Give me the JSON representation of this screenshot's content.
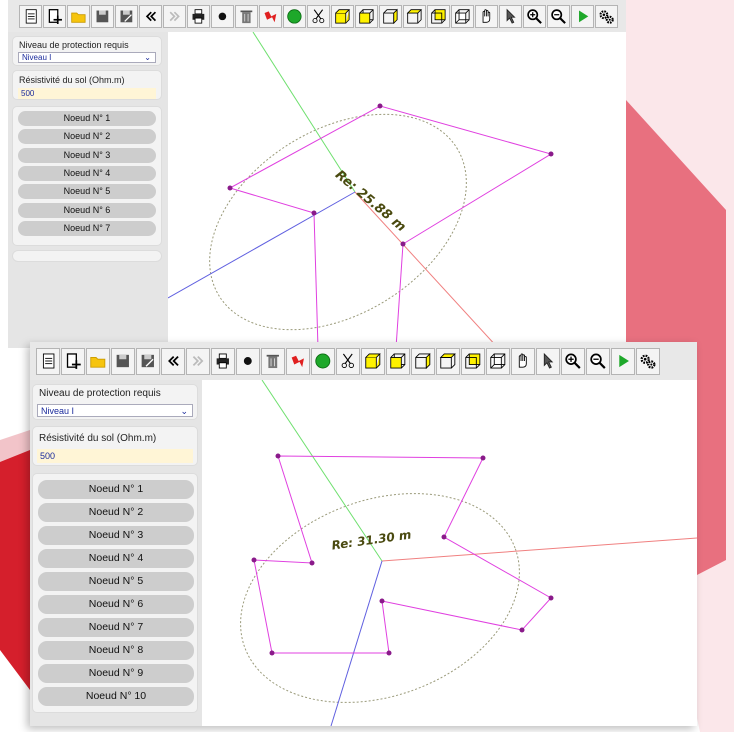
{
  "background_colors": {
    "pink": "#e8707f",
    "red": "#d51f2c",
    "light_pink": "#fbe7ea"
  },
  "toolbar": {
    "buttons": [
      {
        "name": "new-document",
        "icon": "document-icon"
      },
      {
        "name": "add",
        "icon": "add-page-icon"
      },
      {
        "name": "open",
        "icon": "folder-icon"
      },
      {
        "name": "save",
        "icon": "floppy-disk-icon"
      },
      {
        "name": "save-as",
        "icon": "floppy-disk-edit-icon"
      },
      {
        "name": "undo",
        "icon": "double-left-arrow-icon"
      },
      {
        "name": "redo",
        "icon": "double-right-arrow-icon"
      },
      {
        "name": "print",
        "icon": "printer-icon"
      },
      {
        "name": "point",
        "icon": "black-dot-icon"
      },
      {
        "name": "delete",
        "icon": "trash-icon"
      },
      {
        "name": "lightning",
        "icon": "lightning-icon"
      },
      {
        "name": "run",
        "icon": "green-circle-icon"
      },
      {
        "name": "cut",
        "icon": "scissors-icon"
      },
      {
        "name": "view-iso",
        "icon": "cube-iso-icon"
      },
      {
        "name": "view-front",
        "icon": "cube-front-icon"
      },
      {
        "name": "view-side",
        "icon": "cube-side-icon"
      },
      {
        "name": "view-top",
        "icon": "cube-top-icon"
      },
      {
        "name": "view-back",
        "icon": "cube-back-icon"
      },
      {
        "name": "view-wire",
        "icon": "cube-wire-icon"
      },
      {
        "name": "pan",
        "icon": "hand-icon"
      },
      {
        "name": "select",
        "icon": "cursor-arrow-icon"
      },
      {
        "name": "zoom-in",
        "icon": "zoom-in-icon"
      },
      {
        "name": "zoom-out",
        "icon": "zoom-out-icon"
      },
      {
        "name": "play",
        "icon": "play-icon"
      },
      {
        "name": "settings",
        "icon": "gears-icon"
      }
    ]
  },
  "panel": {
    "protection_label": "Niveau de protection requis",
    "protection_value": "Niveau I",
    "resistivity_label": "Résistivité du sol (Ohm.m)",
    "resistivity_value": "500"
  },
  "top_window": {
    "nodes": [
      "Noeud N° 1",
      "Noeud N° 2",
      "Noeud N° 3",
      "Noeud N° 4",
      "Noeud N° 5",
      "Noeud N° 6",
      "Noeud N° 7"
    ],
    "radius_label": "Re: 25.88 m"
  },
  "bottom_window": {
    "nodes": [
      "Noeud N° 1",
      "Noeud N° 2",
      "Noeud N° 3",
      "Noeud N° 4",
      "Noeud N° 5",
      "Noeud N° 6",
      "Noeud N° 7",
      "Noeud N° 8",
      "Noeud N° 9",
      "Noeud N° 10"
    ],
    "radius_label": "Re: 31.30 m"
  }
}
